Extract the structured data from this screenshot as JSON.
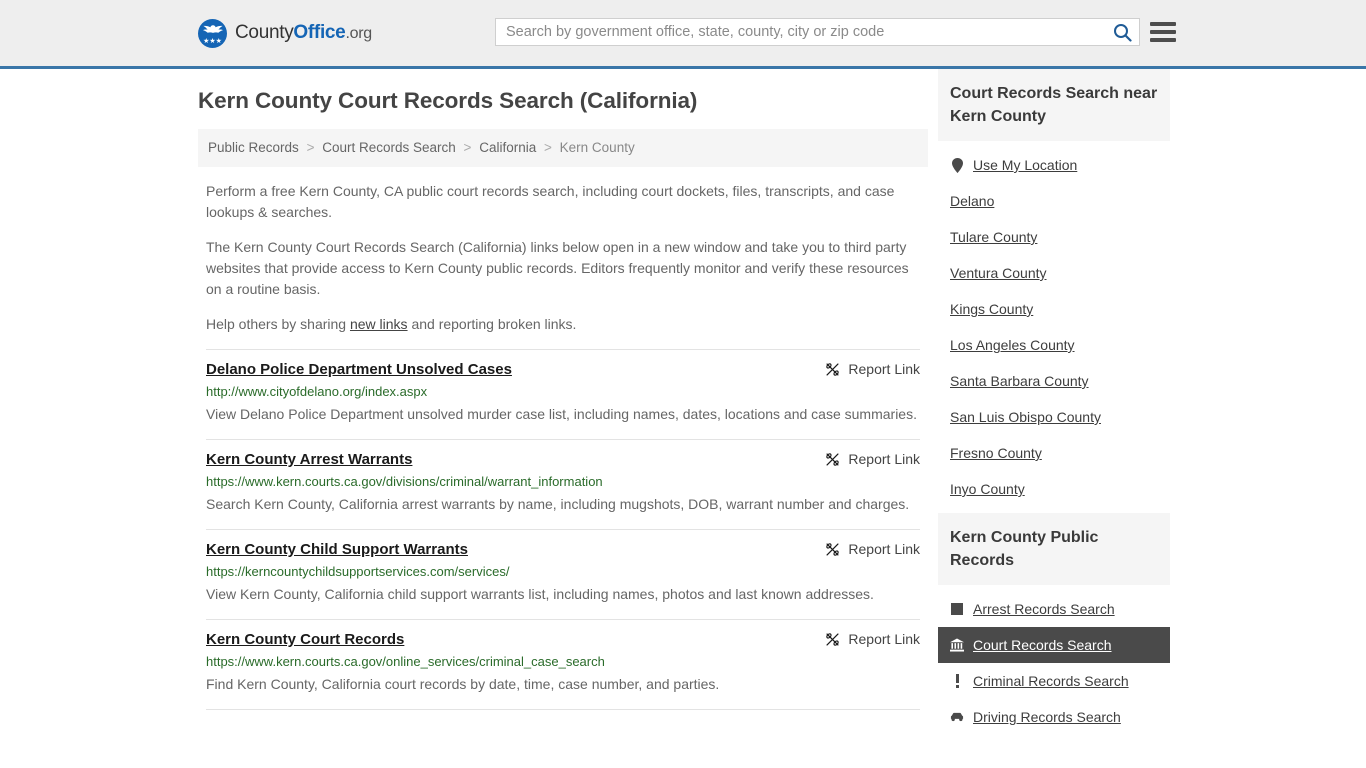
{
  "header": {
    "logo": {
      "part1": "County",
      "part2": "Office",
      "part3": ".org",
      "icon": "eagle-seal-icon"
    },
    "search": {
      "placeholder": "Search by government office, state, county, city or zip code",
      "value": "",
      "icon": "search-icon"
    },
    "menu_icon": "hamburger-menu-icon",
    "accent_color": "#3a76a8"
  },
  "page_title": "Kern County Court Records Search (California)",
  "breadcrumb": {
    "items": [
      "Public Records",
      "Court Records Search",
      "California",
      "Kern County"
    ],
    "separator": ">"
  },
  "intro": {
    "p1": "Perform a free Kern County, CA public court records search, including court dockets, files, transcripts, and case lookups & searches.",
    "p2": "The Kern County Court Records Search (California) links below open in a new window and take you to third party websites that provide access to Kern County public records. Editors frequently monitor and verify these resources on a routine basis.",
    "p3_before": "Help others by sharing ",
    "p3_link": "new links",
    "p3_after": " and reporting broken links."
  },
  "report_link_label": "Report Link",
  "report_link_icon": "broken-link-icon",
  "results": [
    {
      "title": "Delano Police Department Unsolved Cases",
      "url": "http://www.cityofdelano.org/index.aspx",
      "description": "View Delano Police Department unsolved murder case list, including names, dates, locations and case summaries."
    },
    {
      "title": "Kern County Arrest Warrants",
      "url": "https://www.kern.courts.ca.gov/divisions/criminal/warrant_information",
      "description": "Search Kern County, California arrest warrants by name, including mugshots, DOB, warrant number and charges."
    },
    {
      "title": "Kern County Child Support Warrants",
      "url": "https://kerncountychildsupportservices.com/services/",
      "description": "View Kern County, California child support warrants list, including names, photos and last known addresses."
    },
    {
      "title": "Kern County Court Records",
      "url": "https://www.kern.courts.ca.gov/online_services/criminal_case_search",
      "description": "Find Kern County, California court records by date, time, case number, and parties."
    }
  ],
  "sidebar": {
    "nearby": {
      "title": "Court Records Search near Kern County",
      "items": [
        {
          "label": "Use My Location",
          "icon": "map-pin-icon"
        },
        {
          "label": "Delano",
          "icon": ""
        },
        {
          "label": "Tulare County",
          "icon": ""
        },
        {
          "label": "Ventura County",
          "icon": ""
        },
        {
          "label": "Kings County",
          "icon": ""
        },
        {
          "label": "Los Angeles County",
          "icon": ""
        },
        {
          "label": "Santa Barbara County",
          "icon": ""
        },
        {
          "label": "San Luis Obispo County",
          "icon": ""
        },
        {
          "label": "Fresno County",
          "icon": ""
        },
        {
          "label": "Inyo County",
          "icon": ""
        }
      ]
    },
    "public_records": {
      "title": "Kern County Public Records",
      "items": [
        {
          "label": "Arrest Records Search",
          "icon": "square-icon",
          "active": false
        },
        {
          "label": "Court Records Search",
          "icon": "courthouse-icon",
          "active": true
        },
        {
          "label": "Criminal Records Search",
          "icon": "exclamation-icon",
          "active": false
        },
        {
          "label": "Driving Records Search",
          "icon": "car-icon",
          "active": false
        }
      ]
    }
  }
}
